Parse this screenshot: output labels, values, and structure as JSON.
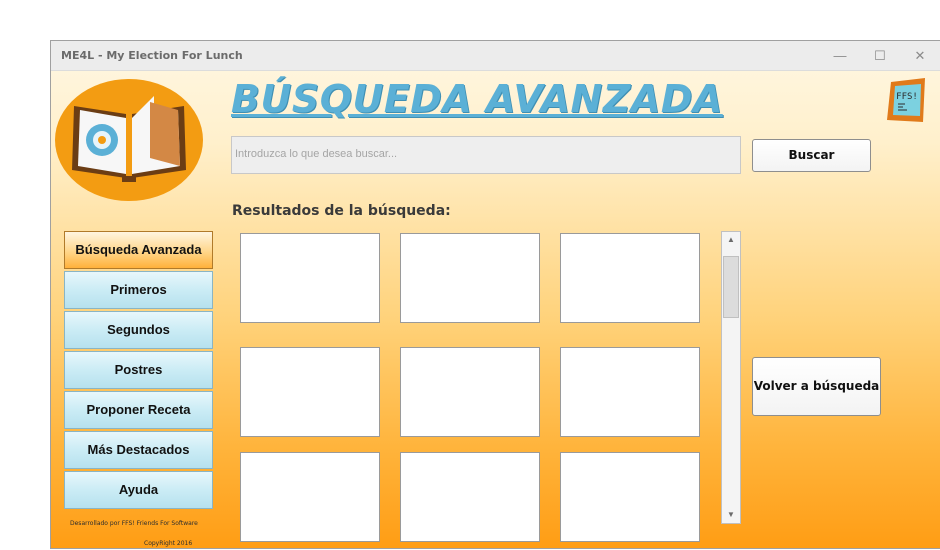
{
  "window": {
    "title": "ME4L - My Election For Lunch",
    "controls": {
      "minimize": "—",
      "maximize": "☐",
      "close": "✕"
    }
  },
  "header": {
    "heading": "BÚSQUEDA AVANZADA",
    "ffs_logo_text": "FFS!"
  },
  "search": {
    "placeholder": "Introduzca lo que desea buscar...",
    "button_label": "Buscar"
  },
  "results": {
    "label": "Resultados de la búsqueda:",
    "back_button_label": "Volver a búsqueda"
  },
  "sidebar": {
    "items": [
      {
        "label": "Búsqueda Avanzada",
        "active": true
      },
      {
        "label": "Primeros",
        "active": false
      },
      {
        "label": "Segundos",
        "active": false
      },
      {
        "label": "Postres",
        "active": false
      },
      {
        "label": "Proponer Receta",
        "active": false
      },
      {
        "label": "Más Destacados",
        "active": false
      },
      {
        "label": "Ayuda",
        "active": false
      }
    ]
  },
  "footer": {
    "developed_by": "Desarrollado por FFS! Friends For Software",
    "copyright": "CopyRight 2016"
  },
  "colors": {
    "heading": "#5bb0d6",
    "accent_orange": "#ff9d14",
    "nav_blue": "#b6e1ee"
  },
  "icons": {
    "app_logo": "book-logo-icon",
    "scroll_up": "scroll-up-arrow-icon",
    "scroll_down": "scroll-down-arrow-icon"
  }
}
